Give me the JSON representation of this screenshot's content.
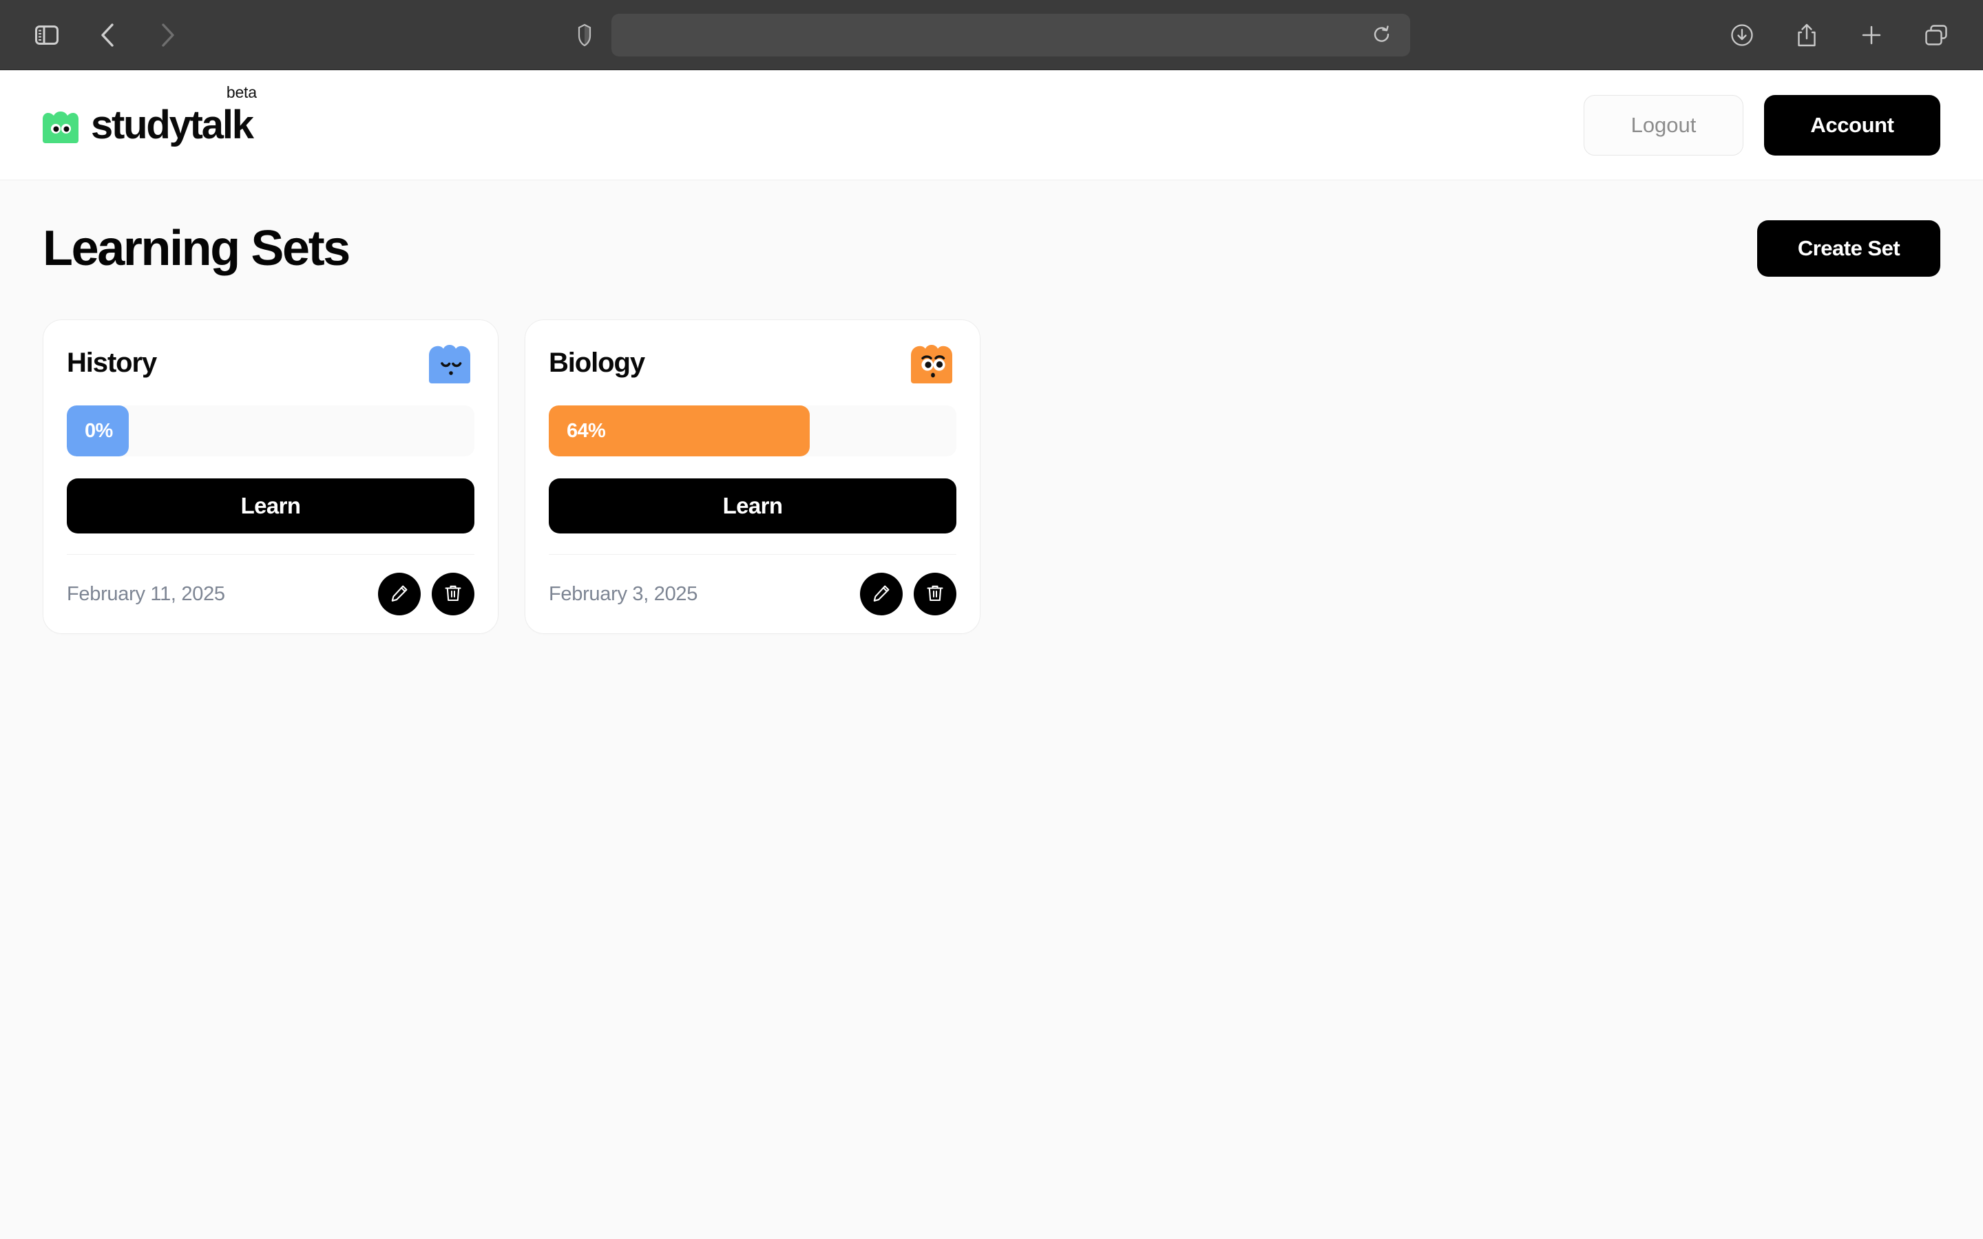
{
  "browser": {
    "sidebar_toggle": "sidebar-toggle",
    "back": "back",
    "forward": "forward",
    "shield": "privacy-shield",
    "url_value": "",
    "url_placeholder": "",
    "reload": "reload",
    "downloads": "downloads",
    "share": "share",
    "new_tab": "new-tab",
    "tab_overview": "tab-overview"
  },
  "header": {
    "brand": "studytalk",
    "beta": "beta",
    "logout_label": "Logout",
    "account_label": "Account"
  },
  "page": {
    "title": "Learning Sets",
    "create_label": "Create Set"
  },
  "colors": {
    "brand_green": "#4ADE80",
    "history_blue": "#6BA4F5",
    "biology_orange": "#FB9337",
    "black": "#000000",
    "track": "#FAFAFA",
    "page_bg": "#FAFAFA",
    "date_text": "#7D8593"
  },
  "cards": [
    {
      "title": "History",
      "progress_label": "0%",
      "progress_value": 0,
      "progress_color": "#6BA4F5",
      "mascot": "sleepy-blue-blob-icon",
      "mascot_color": "#6BA4F5",
      "learn_label": "Learn",
      "date": "February 11, 2025",
      "edit_label": "pencil-icon",
      "delete_label": "trash-icon"
    },
    {
      "title": "Biology",
      "progress_label": "64%",
      "progress_value": 64,
      "progress_color": "#FB9337",
      "mascot": "surprised-orange-blob-icon",
      "mascot_color": "#FB9337",
      "learn_label": "Learn",
      "date": "February 3, 2025",
      "edit_label": "pencil-icon",
      "delete_label": "trash-icon"
    }
  ]
}
